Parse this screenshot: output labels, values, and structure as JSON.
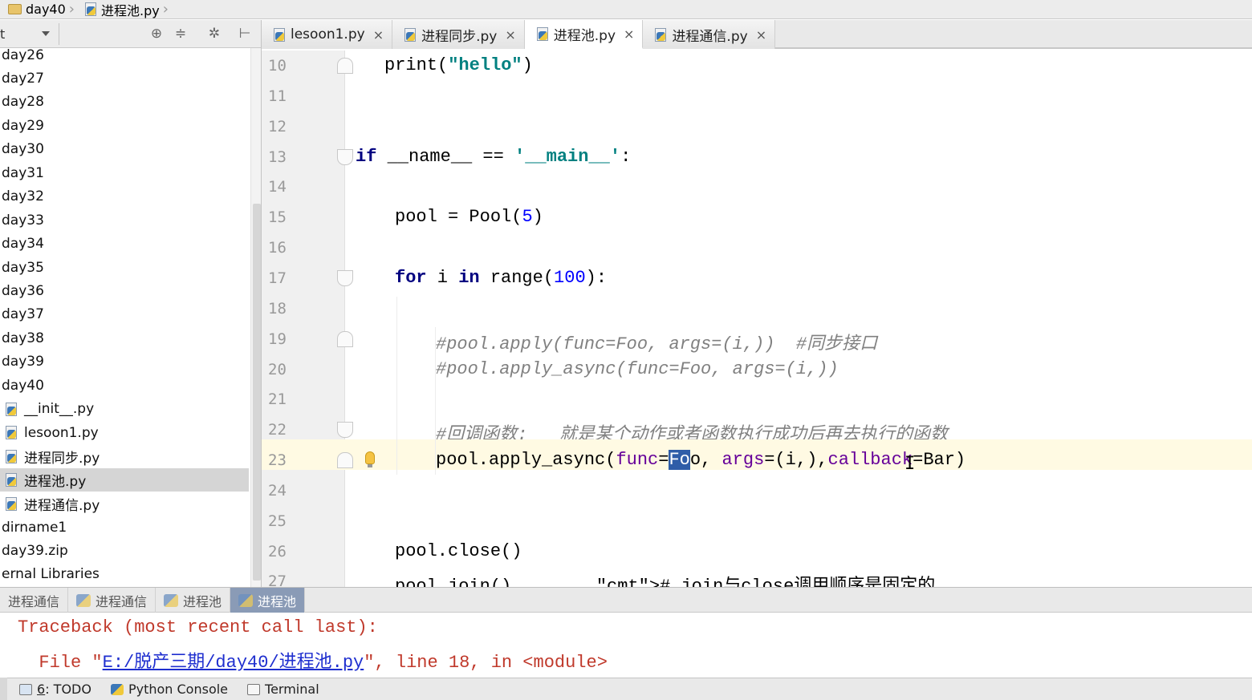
{
  "breadcrumb": {
    "folder": "day40",
    "file": "进程池.py"
  },
  "project_panel": {
    "title": "t",
    "icons": [
      "target-icon",
      "collapse-icon",
      "settings-icon",
      "hide-icon"
    ],
    "tree": [
      {
        "label": "day26",
        "type": "folder"
      },
      {
        "label": "day27",
        "type": "folder"
      },
      {
        "label": "day28",
        "type": "folder"
      },
      {
        "label": "day29",
        "type": "folder"
      },
      {
        "label": "day30",
        "type": "folder"
      },
      {
        "label": "day31",
        "type": "folder"
      },
      {
        "label": "day32",
        "type": "folder"
      },
      {
        "label": "day33",
        "type": "folder"
      },
      {
        "label": "day34",
        "type": "folder"
      },
      {
        "label": "day35",
        "type": "folder"
      },
      {
        "label": "day36",
        "type": "folder"
      },
      {
        "label": "day37",
        "type": "folder"
      },
      {
        "label": "day38",
        "type": "folder"
      },
      {
        "label": "day39",
        "type": "folder"
      },
      {
        "label": "day40",
        "type": "folder"
      },
      {
        "label": "__init__.py",
        "type": "file"
      },
      {
        "label": "lesoon1.py",
        "type": "file"
      },
      {
        "label": "进程同步.py",
        "type": "file"
      },
      {
        "label": "进程池.py",
        "type": "file",
        "selected": true
      },
      {
        "label": "进程通信.py",
        "type": "file"
      },
      {
        "label": "dirname1",
        "type": "folder"
      },
      {
        "label": "day39.zip",
        "type": "folder"
      },
      {
        "label": "ernal Libraries",
        "type": "folder"
      }
    ]
  },
  "editor_tabs": [
    {
      "label": "lesoon1.py",
      "active": false
    },
    {
      "label": "进程同步.py",
      "active": false
    },
    {
      "label": "进程池.py",
      "active": true
    },
    {
      "label": "进程通信.py",
      "active": false
    }
  ],
  "code_lines": [
    {
      "num": "10",
      "text": "print(\"hello\")"
    },
    {
      "num": "11",
      "text": ""
    },
    {
      "num": "12",
      "text": ""
    },
    {
      "num": "13",
      "text": "if __name__ == '__main__':"
    },
    {
      "num": "14",
      "text": ""
    },
    {
      "num": "15",
      "text": "pool = Pool(5)"
    },
    {
      "num": "16",
      "text": ""
    },
    {
      "num": "17",
      "text": "for i in range(100):"
    },
    {
      "num": "18",
      "text": ""
    },
    {
      "num": "19",
      "text": "#pool.apply(func=Foo, args=(i,))  #同步接口"
    },
    {
      "num": "20",
      "text": "#pool.apply_async(func=Foo, args=(i,))"
    },
    {
      "num": "21",
      "text": ""
    },
    {
      "num": "22",
      "text": "#回调函数:   就是某个动作或者函数执行成功后再去执行的函数"
    },
    {
      "num": "23",
      "text": "pool.apply_async(func=Foo, args=(i,),callback=Bar)"
    },
    {
      "num": "24",
      "text": ""
    },
    {
      "num": "25",
      "text": ""
    },
    {
      "num": "26",
      "text": "pool.close()"
    },
    {
      "num": "27",
      "text": "pool.join()        # join与close调用顺序是固定的"
    }
  ],
  "run_tabs": [
    {
      "label": "进程通信",
      "active": false
    },
    {
      "label": "进程通信",
      "active": false
    },
    {
      "label": "进程池",
      "active": false
    },
    {
      "label": "进程池",
      "active": true
    }
  ],
  "console": {
    "line1": "Traceback (most recent call last):",
    "line2_prefix": "  File \"",
    "line2_link": "E:/脱产三期/day40/进程池.py",
    "line2_suffix": "\", line 18, in <module>"
  },
  "status_bar": {
    "todo_num": "6",
    "todo_label": ": TODO",
    "python_console": "Python Console",
    "terminal": "Terminal"
  }
}
